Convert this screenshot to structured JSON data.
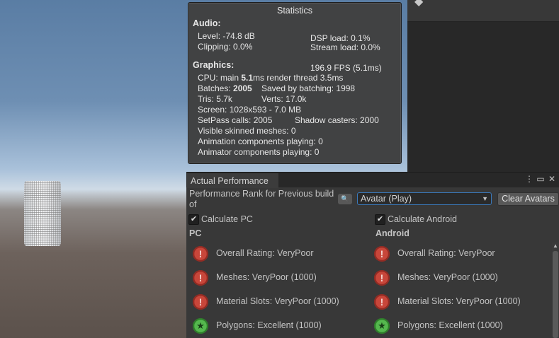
{
  "statistics": {
    "title": "Statistics",
    "audio_header": "Audio:",
    "level": "Level: -74.8 dB",
    "clipping": "Clipping: 0.0%",
    "dsp_load": "DSP load: 0.1%",
    "stream_load": "Stream load: 0.0%",
    "graphics_header": "Graphics:",
    "fps": "196.9 FPS (5.1ms)",
    "cpu_prefix": "CPU: main ",
    "cpu_main": "5.1",
    "cpu_suffix": "ms  render thread 3.5ms",
    "batches_prefix": "Batches: ",
    "batches_value": "2005",
    "saved_batching": "Saved by batching: 1998",
    "tris": "Tris: 5.7k",
    "verts": "Verts: 17.0k",
    "screen": "Screen: 1028x593 - 7.0 MB",
    "setpass": "SetPass calls: 2005",
    "shadow_casters": "Shadow casters: 2000",
    "visible_skinned": "Visible skinned meshes: 0",
    "animation_components": "Animation components playing: 0",
    "animator_components": "Animator components playing: 0"
  },
  "performance_panel": {
    "tab_title": "Actual Performance",
    "tab_icons": {
      "menu": "more-vert-icon",
      "maximize": "maximize-icon",
      "close": "close-icon"
    },
    "rank_label": "Performance Rank for Previous build of",
    "search_icon": "search-icon",
    "avatar_dropdown": "Avatar (Play)",
    "clear_button": "Clear Avatars",
    "calc_pc_label": "Calculate PC",
    "calc_android_label": "Calculate Android",
    "pc_header": "PC",
    "android_header": "Android",
    "pc_rows": [
      {
        "status": "bad",
        "label": "Overall Rating: VeryPoor"
      },
      {
        "status": "bad",
        "label": "Meshes: VeryPoor (1000)"
      },
      {
        "status": "bad",
        "label": "Material Slots: VeryPoor (1000)"
      },
      {
        "status": "good",
        "label": "Polygons: Excellent (1000)"
      }
    ],
    "android_rows": [
      {
        "status": "bad",
        "label": "Overall Rating: VeryPoor"
      },
      {
        "status": "bad",
        "label": "Meshes: VeryPoor (1000)"
      },
      {
        "status": "bad",
        "label": "Material Slots: VeryPoor (1000)"
      },
      {
        "status": "good",
        "label": "Polygons: Excellent (1000)"
      }
    ]
  },
  "colors": {
    "panel_bg": "#383838",
    "stats_bg": "#414243",
    "dropdown_border": "#3a79bb",
    "bad_icon": "#c8463a",
    "good_icon": "#55b84e"
  }
}
